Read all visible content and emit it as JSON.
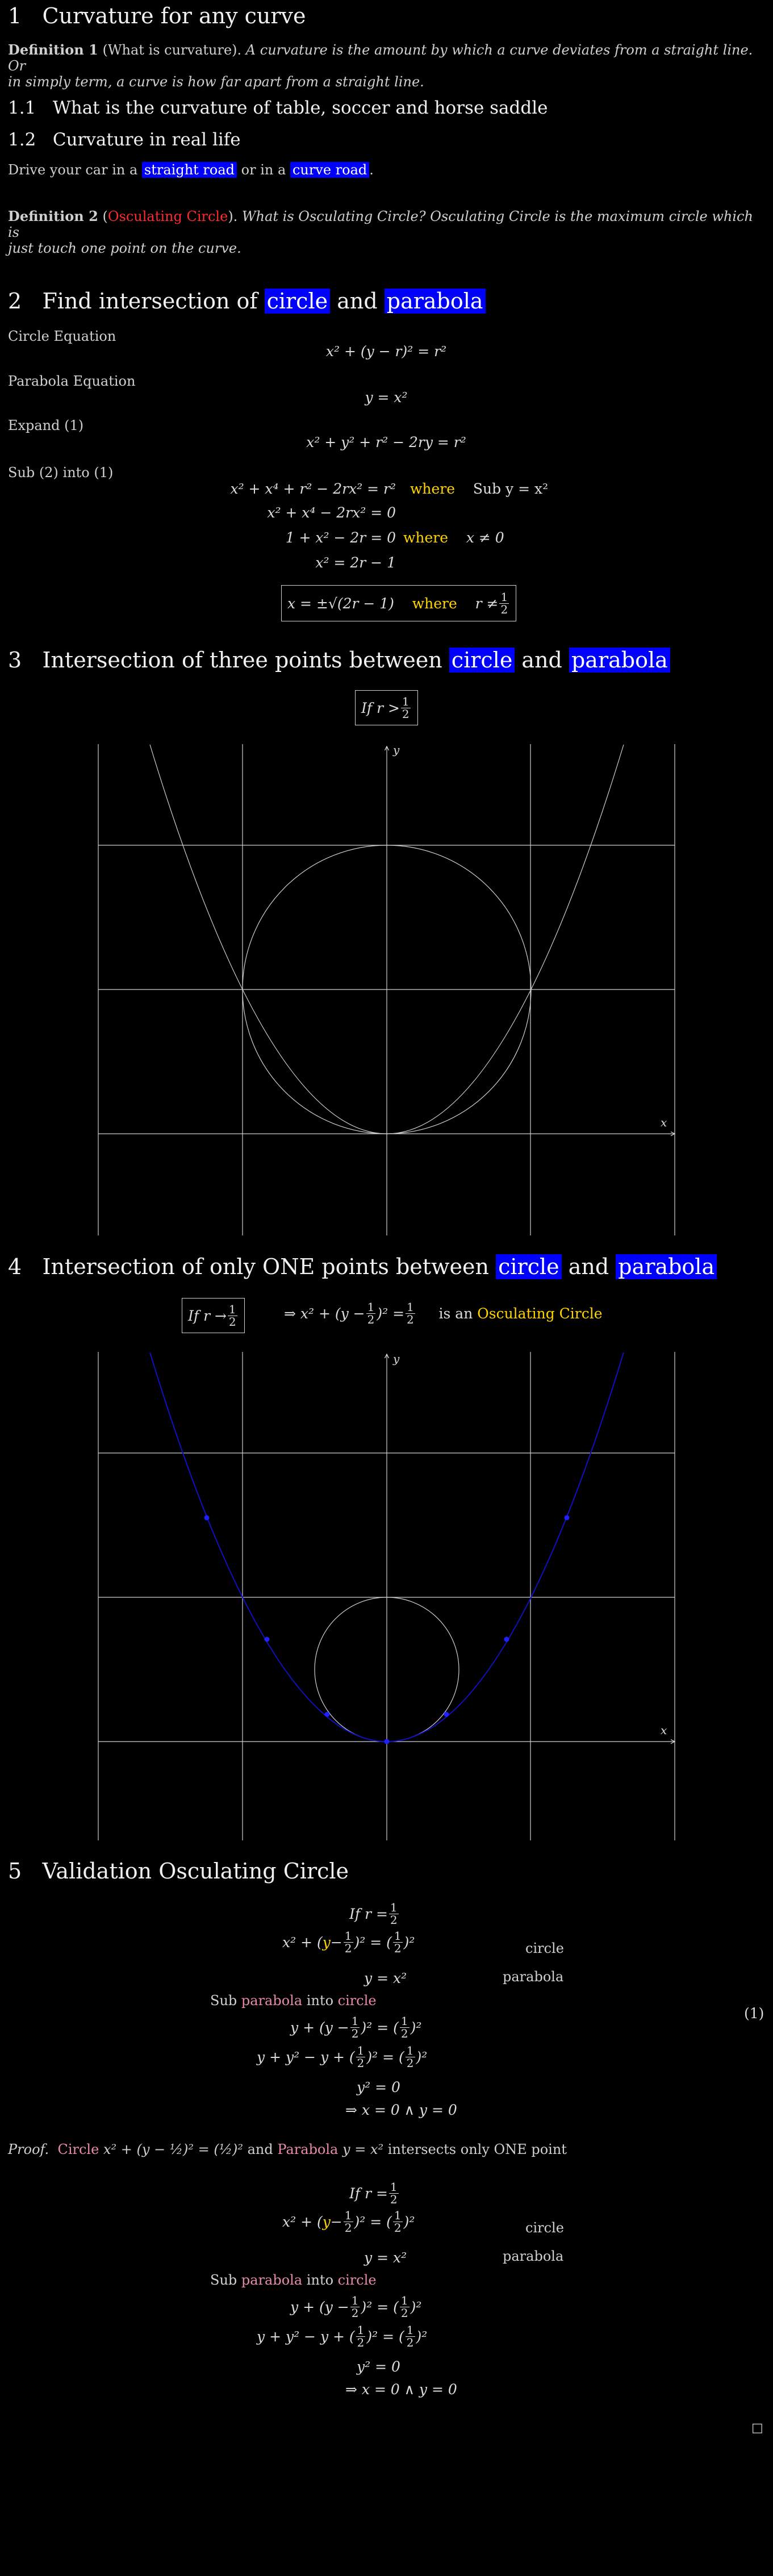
{
  "s1": {
    "num": "1",
    "title": "Curvature for any curve"
  },
  "def1": {
    "label": "Definition 1",
    "name": "(What is curvature).",
    "text_line1": "A curvature is the amount by which a curve deviates from a straight line. Or",
    "text_line2": "in simply term, a curve is how far apart from a straight line."
  },
  "s11": {
    "num": "1.1",
    "title": "What is the curvature of table, soccer and horse saddle"
  },
  "s12": {
    "num": "1.2",
    "title": "Curvature in real life"
  },
  "drive": {
    "pre": "Drive your car in a",
    "hl1": "straight road",
    "mid": "or in a",
    "hl2": "curve road",
    "post": "."
  },
  "def2": {
    "label": "Definition 2",
    "open": "(",
    "name": "Osculating Circle",
    "close": ").",
    "text_line1": "What is Osculating Circle? Osculating Circle is the maximum circle which is",
    "text_line2": "just touch one point on the curve."
  },
  "s2": {
    "num": "2",
    "pre": "Find intersection of",
    "hl1": "circle",
    "mid": "and",
    "hl2": "parabola"
  },
  "s2body": {
    "circle_eq_label": "Circle Equation",
    "circle_eq": "x² + (y − r)² = r²",
    "parabola_eq_label": "Parabola Equation",
    "parabola_eq": "y = x²",
    "expand_label": "Expand (1)",
    "expand_eq": "x² + y² + r² − 2ry = r²",
    "sub_label": "Sub (2) into (1)",
    "sub1_left": "x² + x⁴ + r² − 2rx² = r²",
    "where": "where",
    "sub1_right": "Sub y = x²",
    "sub2": "x² + x⁴ − 2rx² = 0",
    "sub3_left": "1 + x² − 2r = 0",
    "sub3_right": "x ≠ 0",
    "sub4": "x² = 2r − 1",
    "boxed_left": "x = ±√(2r − 1)",
    "boxed_right_pre": "r ≠",
    "frac_n": "1",
    "frac_d": "2"
  },
  "s3": {
    "num": "3",
    "pre": "Intersection of three points between",
    "hl1": "circle",
    "mid": "and",
    "hl2": "parabola",
    "cond_pre": "If r >",
    "frac_n": "1",
    "frac_d": "2",
    "axis_y": "y",
    "axis_x": "x"
  },
  "s4": {
    "num": "4",
    "pre": "Intersection of only ONE points between",
    "hl1": "circle",
    "mid": "and",
    "hl2": "parabola",
    "cond_pre": "If r →",
    "frac_n": "1",
    "frac_d": "2",
    "arrow_eq": "⇒ x² + (y − ",
    "arrow_eq2": ")² =",
    "is_an": "is an",
    "osc": "Osculating Circle",
    "axis_y": "y",
    "axis_x": "x"
  },
  "s5": {
    "num": "5",
    "title": "Validation Osculating Circle"
  },
  "val": {
    "if_r": "If r =",
    "half_n": "1",
    "half_d": "2",
    "circle_lbl": "circle",
    "parabola_lbl": "parabola",
    "eq_parab": "y = x²",
    "sub_pre": "Sub",
    "sub_parabola": "parabola",
    "sub_into": "into",
    "sub_circle": "circle",
    "y2": "y² = 0",
    "result": "⇒ x = 0    ∧    y = 0",
    "eqnum": "(1)"
  },
  "proof": {
    "label": "Proof.",
    "circle": "Circle",
    "eq": "x² + (y − ½)² = (½)²",
    "and": "and",
    "parabola": "Parabola",
    "peq": "y = x²",
    "tail": "intersects only ONE point",
    "qed": "□"
  }
}
